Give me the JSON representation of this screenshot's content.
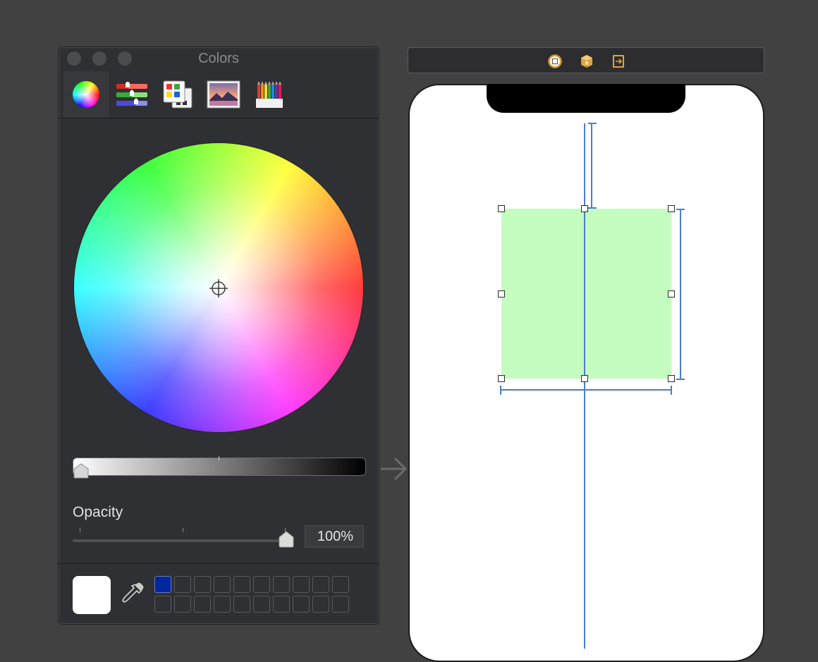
{
  "colors_panel": {
    "title": "Colors",
    "modes": [
      {
        "name": "color-wheel",
        "selected": true
      },
      {
        "name": "color-sliders",
        "selected": false
      },
      {
        "name": "color-palettes",
        "selected": false
      },
      {
        "name": "image-palettes",
        "selected": false
      },
      {
        "name": "pencils",
        "selected": false
      }
    ],
    "brightness_value": 1.0,
    "opacity": {
      "label": "Opacity",
      "value_text": "100%",
      "fraction": 1.0
    },
    "current_color": "#ffffff",
    "swatch_colors": [
      "#0026a0",
      "",
      "",
      "",
      "",
      "",
      "",
      "",
      "",
      "",
      "",
      "",
      "",
      "",
      "",
      "",
      "",
      "",
      "",
      ""
    ]
  },
  "canvas": {
    "background_color": "#414141",
    "view_color": "#c5fcc0",
    "constraint_color": "#4a7fc4",
    "scene_icons": [
      "view-controller-icon",
      "first-responder-icon",
      "exit-icon"
    ]
  }
}
